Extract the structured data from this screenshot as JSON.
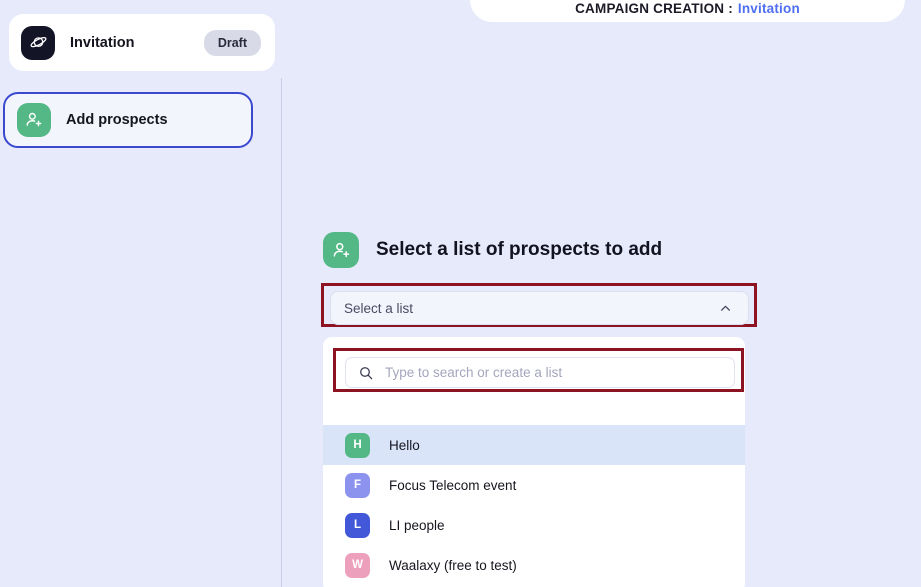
{
  "header": {
    "breadcrumb_label": "CAMPAIGN CREATION :",
    "breadcrumb_value": "Invitation",
    "accent_color": "#4f6ef0"
  },
  "sidebar": {
    "steps": [
      {
        "label": "Invitation",
        "icon": "planet-icon",
        "icon_bg": "#141427",
        "badge": "Draft"
      },
      {
        "label": "Add prospects",
        "icon": "add-person-icon",
        "icon_bg": "#54b886",
        "badge": null
      }
    ]
  },
  "main": {
    "heading": "Select a list of prospects to add",
    "heading_icon": "add-person-icon",
    "heading_icon_bg": "#54b886",
    "select": {
      "placeholder": "Select a list",
      "chevron": "chevron-up-icon",
      "expanded": true
    },
    "search": {
      "placeholder": "Type to search or create a list",
      "value": "",
      "icon": "search-icon"
    },
    "lists": [
      {
        "initial": "H",
        "label": "Hello",
        "color": "#54b886",
        "selected": true
      },
      {
        "initial": "F",
        "label": "Focus Telecom event",
        "color": "#8b93ee",
        "selected": false
      },
      {
        "initial": "L",
        "label": "LI people",
        "color": "#4358d8",
        "selected": false
      },
      {
        "initial": "W",
        "label": "Waalaxy (free to test)",
        "color": "#eda0bb",
        "selected": false
      }
    ]
  },
  "annotations": {
    "highlight_color": "#8e1322",
    "boxes": [
      "select-field-highlight",
      "search-field-highlight"
    ]
  }
}
